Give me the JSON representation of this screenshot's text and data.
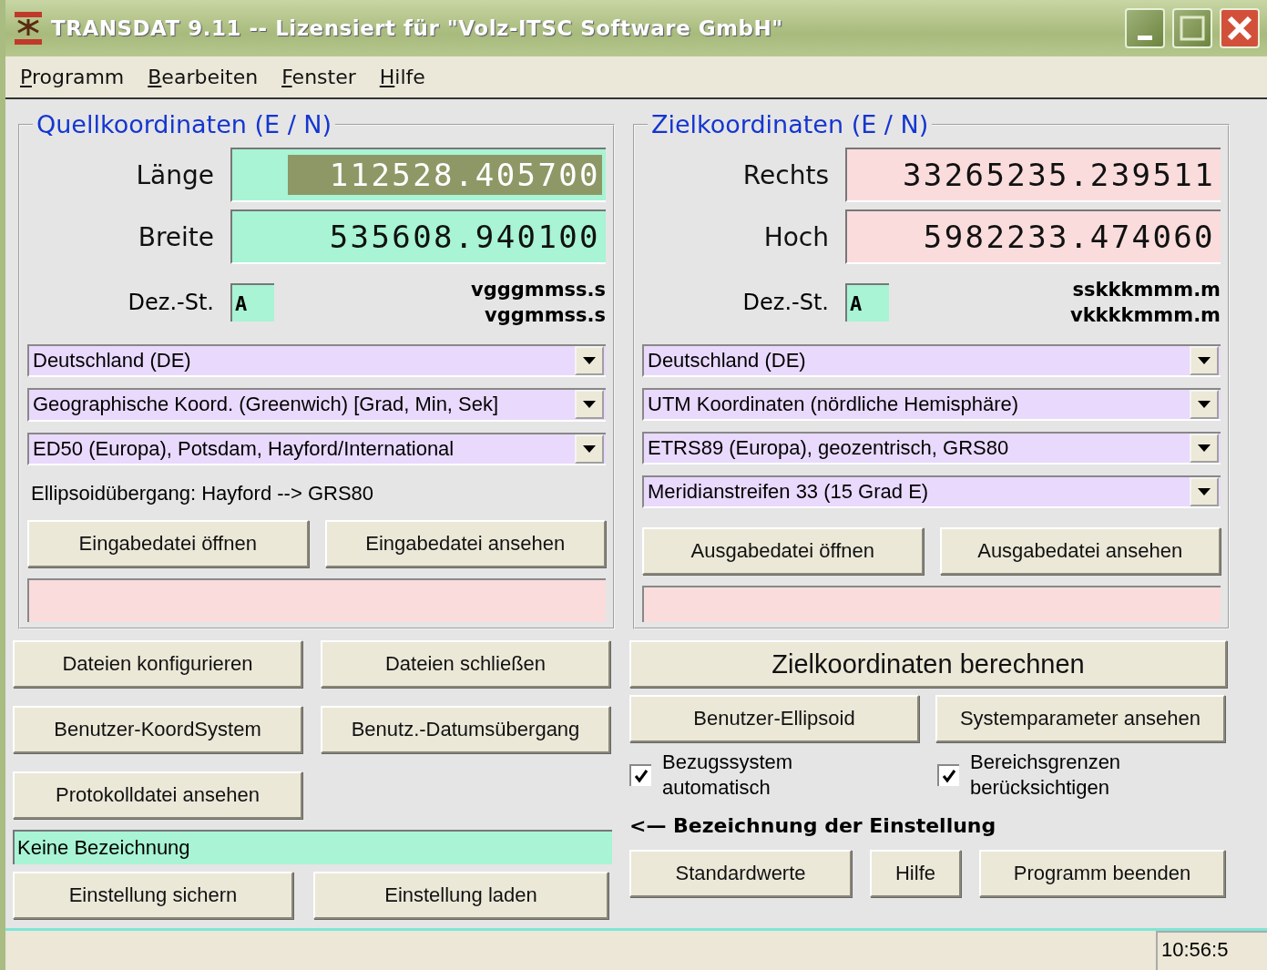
{
  "window": {
    "title": "TRANSDAT 9.11 -- Lizensiert für \"Volz-ITSC Software GmbH\""
  },
  "menu": [
    {
      "label": "Programm"
    },
    {
      "label": "Bearbeiten"
    },
    {
      "label": "Fenster"
    },
    {
      "label": "Hilfe"
    }
  ],
  "source": {
    "title": "Quellkoordinaten (E / N)",
    "fields": [
      {
        "label": "Länge",
        "value": "112528.405700",
        "highlighted": true
      },
      {
        "label": "Breite",
        "value": "535608.940100",
        "highlighted": false
      }
    ],
    "decimals": {
      "label": "Dez.-St.",
      "value": "A"
    },
    "formats": [
      "vgggmmss.s",
      "vggmmss.s"
    ],
    "dropdowns": [
      "Deutschland (DE)",
      "Geographische Koord. (Greenwich) [Grad, Min, Sek]",
      "ED50 (Europa), Potsdam, Hayford/International"
    ],
    "note": "Ellipsoidübergang: Hayford --> GRS80",
    "buttons": [
      "Eingabedatei öffnen",
      "Eingabedatei ansehen"
    ]
  },
  "target": {
    "title": "Zielkoordinaten (E / N)",
    "fields": [
      {
        "label": "Rechts",
        "value": "33265235.239511",
        "highlighted": false
      },
      {
        "label": "Hoch",
        "value": "5982233.474060",
        "highlighted": false
      }
    ],
    "decimals": {
      "label": "Dez.-St.",
      "value": "A"
    },
    "formats": [
      "sskkkmmm.m",
      "vkkkkmmm.m"
    ],
    "dropdowns": [
      "Deutschland (DE)",
      "UTM Koordinaten (nördliche Hemisphäre)",
      "ETRS89 (Europa), geozentrisch, GRS80",
      "Meridianstreifen 33 (15 Grad E)"
    ],
    "buttons": [
      "Ausgabedatei öffnen",
      "Ausgabedatei ansehen"
    ]
  },
  "left_buttons": [
    "Dateien konfigurieren",
    "Dateien schließen",
    "Benutzer-KoordSystem",
    "Benutz.-Datumsübergang",
    "Protokolldatei ansehen"
  ],
  "setting_name": {
    "value": "Keine Bezeichnung"
  },
  "setting_buttons": [
    "Einstellung sichern",
    "Einstellung laden"
  ],
  "compute_button": "Zielkoordinaten berechnen",
  "right_buttons": [
    "Benutzer-Ellipsoid",
    "Systemparameter ansehen"
  ],
  "checkboxes": [
    {
      "label": "Bezugssystem automatisch",
      "checked": true
    },
    {
      "label": "Bereichsgrenzen berücksichtigen",
      "checked": true
    }
  ],
  "setting_hint": "<— Bezeichnung der Einstellung",
  "bottom_buttons": [
    "Standardwerte",
    "Hilfe",
    "Programm beenden"
  ],
  "status_bar": {
    "time": "10:56:5"
  }
}
